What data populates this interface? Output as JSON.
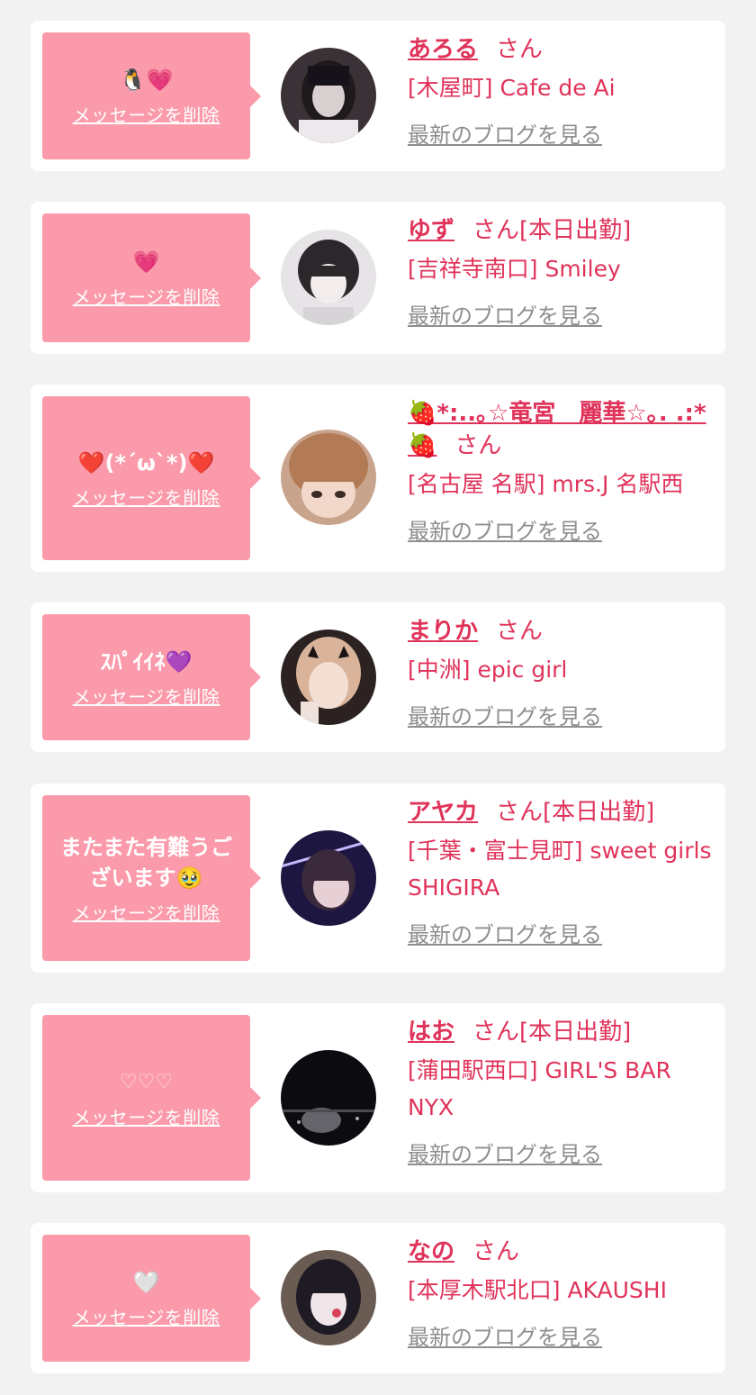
{
  "delete_label": "メッセージを削除",
  "honorific": "さん",
  "blog_label": "最新のブログを見る",
  "colors": {
    "bubble": "#fb9aaa",
    "accent": "#e0335a",
    "link_gray": "#8e8e8e",
    "background": "#f2f2f2"
  },
  "entries": [
    {
      "message": "🐧💗",
      "name": "あろる",
      "work_status": "",
      "shop": "[木屋町] Cafe de Ai"
    },
    {
      "message": "💗",
      "name": "ゆず",
      "work_status": "[本日出勤]",
      "shop": "[吉祥寺南口] Smiley"
    },
    {
      "message": "❤️(*´ω`*)❤️",
      "name": "🍓*:..｡☆竜宮　麗華☆｡. .:*🍓",
      "work_status": "",
      "shop": "[名古屋 名駅] mrs.J 名駅西"
    },
    {
      "message": "ｽﾊﾟｲｲﾈ💜",
      "name": "まりか",
      "work_status": "",
      "shop": "[中洲] epic girl"
    },
    {
      "message": "またまた有難うございます🥹",
      "name": "アヤカ",
      "work_status": "[本日出勤]",
      "shop": "[千葉・富士見町] sweet girls SHIGIRA"
    },
    {
      "message": "♡♡♡",
      "name": "はお",
      "work_status": "[本日出勤]",
      "shop": "[蒲田駅西口] GIRL'S BAR NYX"
    },
    {
      "message": "🤍",
      "name": "なの",
      "work_status": "",
      "shop": "[本厚木駅北口] AKAUSHI"
    }
  ]
}
